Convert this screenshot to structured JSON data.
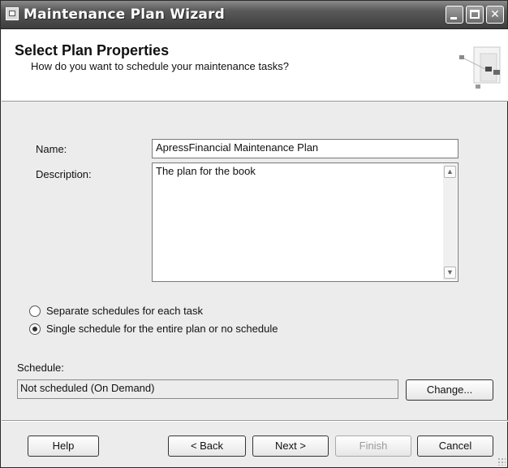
{
  "window": {
    "title": "Maintenance Plan Wizard",
    "minimize_label": "",
    "close_label": "✕"
  },
  "header": {
    "title": "Select Plan Properties",
    "subtitle": "How do you want to schedule your maintenance tasks?"
  },
  "form": {
    "name_label": "Name:",
    "name_value": "ApressFinancial Maintenance Plan",
    "description_label": "Description:",
    "description_value": "The plan for the book",
    "scroll_up": "▲",
    "scroll_down": "▼"
  },
  "schedule_options": [
    {
      "label": "Separate schedules for each task",
      "selected": false
    },
    {
      "label": "Single schedule for the entire plan or no schedule",
      "selected": true
    }
  ],
  "schedule": {
    "label": "Schedule:",
    "value": "Not scheduled (On Demand)",
    "change_label": "Change..."
  },
  "footer": {
    "help_label": "Help",
    "back_label": "< Back",
    "next_label": "Next >",
    "finish_label": "Finish",
    "cancel_label": "Cancel"
  }
}
